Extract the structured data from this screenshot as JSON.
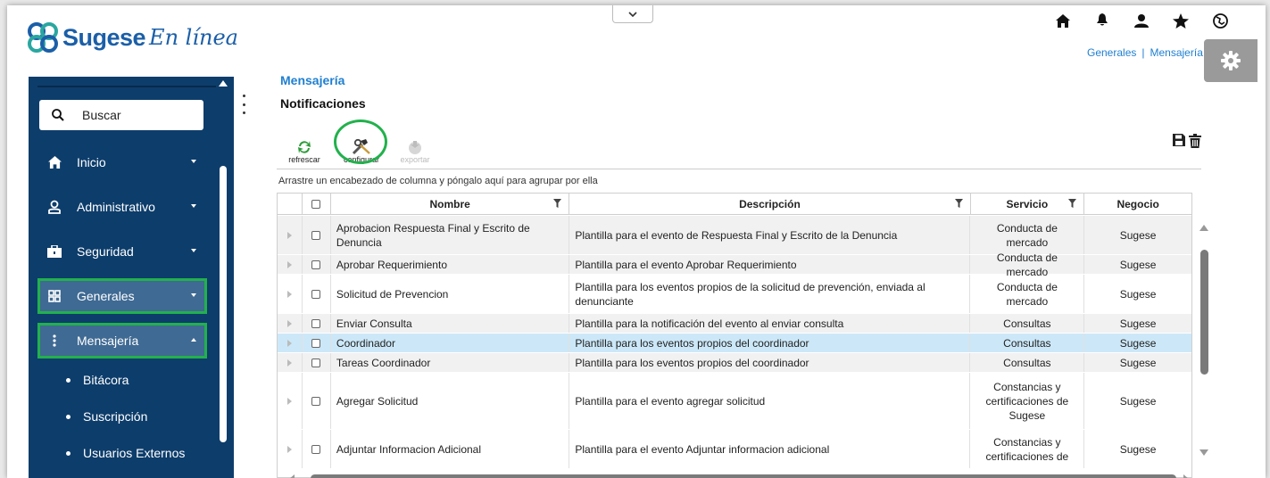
{
  "app": {
    "brand": "Sugese",
    "brand_script": "En línea"
  },
  "header": {
    "icons": [
      "home-icon",
      "bell-icon",
      "user-icon",
      "star-icon",
      "globe-icon"
    ],
    "breadcrumb": [
      "Generales",
      "|",
      "Mensajería"
    ]
  },
  "sidebar": {
    "search_placeholder": "Buscar",
    "items": [
      {
        "label": "Inicio",
        "icon": "home-icon"
      },
      {
        "label": "Administrativo",
        "icon": "person-icon"
      },
      {
        "label": "Seguridad",
        "icon": "briefcase-icon"
      },
      {
        "label": "Generales",
        "icon": "grid-icon"
      },
      {
        "label": "Mensajería",
        "icon": "dots-icon"
      }
    ],
    "subitems": [
      "Bitácora",
      "Suscripción",
      "Usuarios Externos"
    ]
  },
  "main": {
    "title": "Mensajería",
    "subtitle": "Notificaciones",
    "toolbar": {
      "refresh": "refrescar",
      "configure": "configurar",
      "export": "exportar"
    },
    "group_hint": "Arrastre un encabezado de columna y póngalo aquí para agrupar por ella",
    "columns": [
      "Nombre",
      "Descripción",
      "Servicio",
      "Negocio"
    ],
    "rows": [
      {
        "nombre": "Aprobacion Respuesta Final y Escrito de Denuncia",
        "descripcion": "Plantilla para el evento de Respuesta Final y Escrito de la Denuncia",
        "servicio": "Conducta de mercado",
        "negocio": "Sugese"
      },
      {
        "nombre": "Aprobar Requerimiento",
        "descripcion": "Plantilla para el evento Aprobar Requerimiento",
        "servicio": "Conducta de mercado",
        "negocio": "Sugese"
      },
      {
        "nombre": "Solicitud de Prevencion",
        "descripcion": "Plantilla para los eventos propios de la solicitud de prevención, enviada al denunciante",
        "servicio": "Conducta de mercado",
        "negocio": "Sugese"
      },
      {
        "nombre": "Enviar Consulta",
        "descripcion": "Plantilla para la notificación del evento al enviar consulta",
        "servicio": "Consultas",
        "negocio": "Sugese"
      },
      {
        "nombre": "Coordinador",
        "descripcion": "Plantilla para los eventos propios del coordinador",
        "servicio": "Consultas",
        "negocio": "Sugese"
      },
      {
        "nombre": "Tareas Coordinador",
        "descripcion": "Plantilla para los eventos propios del coordinador",
        "servicio": "Consultas",
        "negocio": "Sugese"
      },
      {
        "nombre": "Agregar Solicitud",
        "descripcion": "Plantilla para el evento agregar solicitud",
        "servicio": "Constancias y certificaciones de Sugese",
        "negocio": "Sugese"
      },
      {
        "nombre": "Adjuntar Informacion Adicional",
        "descripcion": "Plantilla para el evento Adjuntar informacion adicional",
        "servicio": "Constancias y certificaciones de",
        "negocio": "Sugese"
      }
    ]
  },
  "colors": {
    "brand_blue": "#1b5fa8",
    "sidebar_bg": "#0d3d6b",
    "highlight_green": "#22b14c",
    "selected_row": "#cce8f8"
  }
}
